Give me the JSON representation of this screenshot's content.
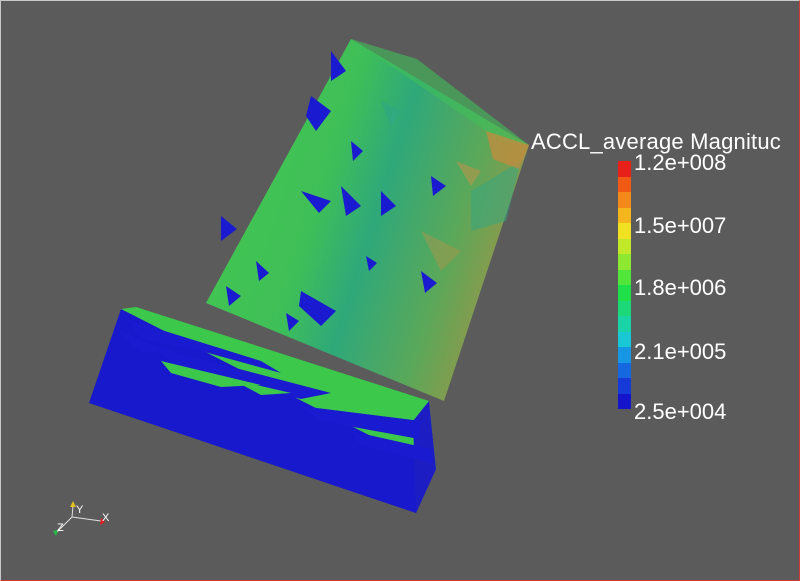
{
  "colorbar": {
    "title": "ACCL_average Magnituc",
    "labels": [
      "1.2e+008",
      "1.5e+007",
      "1.8e+006",
      "2.1e+005",
      "2.5e+004"
    ],
    "colors_top_to_bottom": [
      "#e8201a",
      "#f05a14",
      "#f3891a",
      "#f5b51c",
      "#f0e222",
      "#c2e82a",
      "#8ee832",
      "#52e53a",
      "#20e04a",
      "#1cd878",
      "#1ad4a8",
      "#19c8d4",
      "#1796e4",
      "#1668e0",
      "#153ad8",
      "#1414cc"
    ]
  },
  "axes": {
    "x_label": "X",
    "y_label": "Y",
    "z_label": "Z"
  },
  "colors": {
    "background": "#5b5b5b",
    "mesh_green": "#3cc84a",
    "mesh_blue": "#1a1ad0",
    "mesh_teal": "#2fa883",
    "mesh_orange": "#c98a3c",
    "viewport_border": "#d23a3a"
  }
}
